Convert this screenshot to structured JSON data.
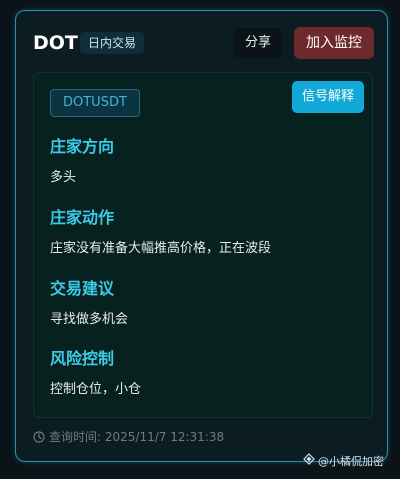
{
  "header": {
    "coin": "DOT",
    "trade_type": "日内交易",
    "share_label": "分享",
    "monitor_label": "加入监控"
  },
  "panel": {
    "symbol": "DOTUSDT",
    "explain_label": "信号解释",
    "sections": [
      {
        "title": "庄家方向",
        "text": "多头"
      },
      {
        "title": "庄家动作",
        "text": "庄家没有准备大幅推高价格，正在波段"
      },
      {
        "title": "交易建议",
        "text": "寻找做多机会"
      },
      {
        "title": "风险控制",
        "text": "控制仓位，小仓"
      }
    ]
  },
  "footer": {
    "query_time": "查询时间: 2025/11/7 12:31:38",
    "icon": "clock-icon"
  },
  "watermark": {
    "text": "@小橘侃加密",
    "icon": "diamond-logo-icon"
  },
  "colors": {
    "card_border": "#2a8fb8",
    "accent_cyan": "#3ccbe6",
    "monitor_button": "#6d2a2c",
    "explain_button": "#12a9d8"
  }
}
